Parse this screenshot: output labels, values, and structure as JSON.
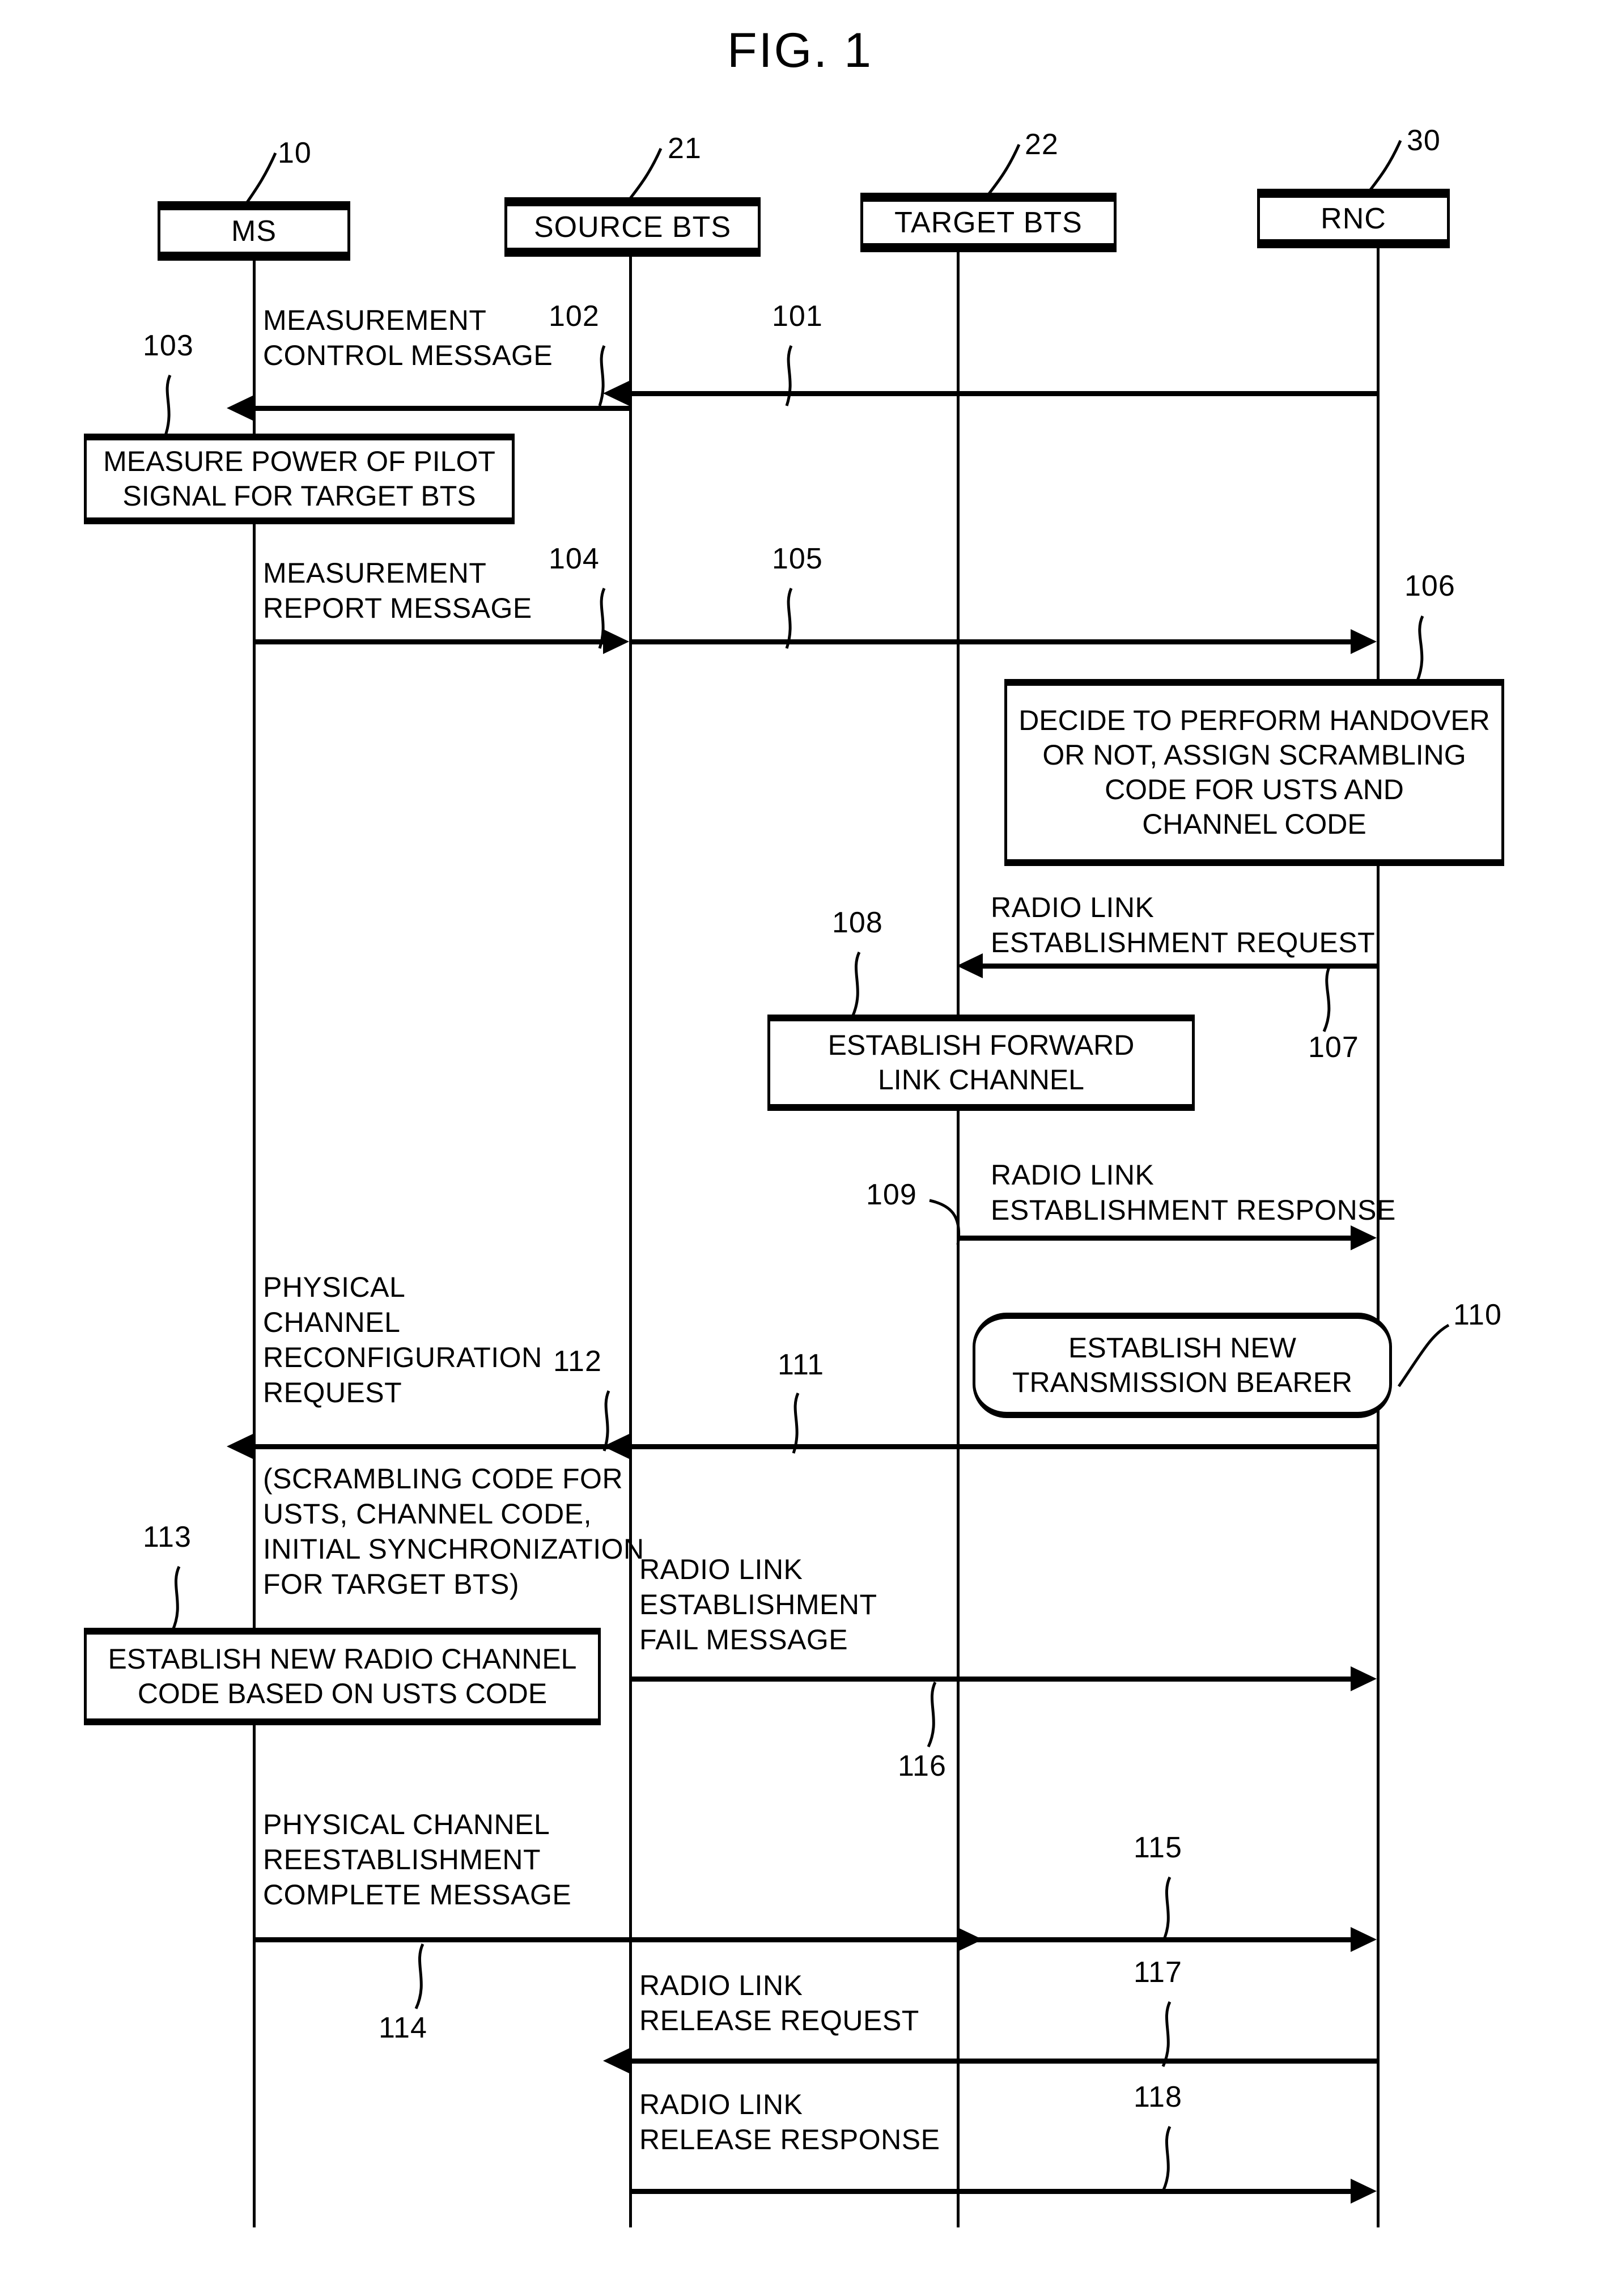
{
  "figure": {
    "title": "FIG. 1",
    "type": "patent-sequence-diagram"
  },
  "actors": [
    {
      "label": "MS",
      "ref": "10"
    },
    {
      "label": "SOURCE BTS",
      "ref": "21"
    },
    {
      "label": "TARGET BTS",
      "ref": "22"
    },
    {
      "label": "RNC",
      "ref": "30"
    }
  ],
  "messages": [
    {
      "ref": "101",
      "from": "RNC",
      "to": "SOURCE BTS",
      "label_line1": "",
      "label_line2": ""
    },
    {
      "ref": "102",
      "from": "SOURCE BTS",
      "to": "MS",
      "label_line1": "MEASUREMENT",
      "label_line2": "CONTROL MESSAGE"
    },
    {
      "ref": "104",
      "from": "MS",
      "to": "SOURCE BTS",
      "label_line1": "MEASUREMENT",
      "label_line2": "REPORT MESSAGE"
    },
    {
      "ref": "105",
      "from": "SOURCE BTS",
      "to": "RNC",
      "label_line1": "",
      "label_line2": ""
    },
    {
      "ref": "107",
      "from": "RNC",
      "to": "TARGET BTS",
      "label_line1": "RADIO LINK",
      "label_line2": "ESTABLISHMENT REQUEST"
    },
    {
      "ref": "109",
      "from": "TARGET BTS",
      "to": "RNC",
      "label_line1": "RADIO LINK",
      "label_line2": "ESTABLISHMENT RESPONSE"
    },
    {
      "ref": "111",
      "from": "RNC",
      "to": "SOURCE BTS",
      "label_line1": "",
      "label_line2": ""
    },
    {
      "ref": "112",
      "from": "SOURCE BTS",
      "to": "MS",
      "label_line1": "PHYSICAL CHANNEL RECONFIGURATION REQUEST",
      "label_line2": "(SCRAMBLING CODE FOR USTS, CHANNEL CODE, INITIAL SYNCHRONIZATION FOR TARGET BTS)"
    },
    {
      "ref": "116",
      "from": "SOURCE BTS",
      "to": "RNC",
      "label_line1": "RADIO LINK",
      "label_line2": "ESTABLISHMENT FAIL MESSAGE"
    },
    {
      "ref": "114",
      "from": "MS",
      "to": "SOURCE BTS",
      "label_line1": "PHYSICAL CHANNEL REESTABLISHMENT",
      "label_line2": "COMPLETE MESSAGE"
    },
    {
      "ref": "115",
      "from": "SOURCE BTS",
      "to": "RNC",
      "label_line1": "",
      "label_line2": ""
    },
    {
      "ref": "117",
      "from": "RNC",
      "to": "SOURCE BTS",
      "label_line1": "RADIO LINK",
      "label_line2": "RELEASE REQUEST"
    },
    {
      "ref": "118",
      "from": "SOURCE BTS",
      "to": "RNC",
      "label_line1": "RADIO LINK",
      "label_line2": "RELEASE RESPONSE"
    }
  ],
  "labels": {
    "m102_l1": "MEASUREMENT",
    "m102_l2": "CONTROL MESSAGE",
    "m104_l1": "MEASUREMENT",
    "m104_l2": "REPORT MESSAGE",
    "m107_l1": "RADIO LINK",
    "m107_l2": "ESTABLISHMENT REQUEST",
    "m109_l1": "RADIO LINK",
    "m109_l2": "ESTABLISHMENT RESPONSE",
    "m112_l1": "PHYSICAL",
    "m112_l2": "CHANNEL",
    "m112_l3": "RECONFIGURATION",
    "m112_l4": "REQUEST",
    "m112_p1": "(SCRAMBLING CODE FOR",
    "m112_p2": "USTS, CHANNEL CODE,",
    "m112_p3": "INITIAL SYNCHRONIZATION",
    "m112_p4": "FOR TARGET BTS)",
    "m116_l1": "RADIO LINK",
    "m116_l2": "ESTABLISHMENT",
    "m116_l3": "FAIL MESSAGE",
    "m114_l1": "PHYSICAL CHANNEL",
    "m114_l2": "REESTABLISHMENT",
    "m114_l3": "COMPLETE MESSAGE",
    "m117_l1": "RADIO LINK",
    "m117_l2": "RELEASE REQUEST",
    "m118_l1": "RADIO LINK",
    "m118_l2": "RELEASE RESPONSE"
  },
  "process_boxes": [
    {
      "ref": "103",
      "actor": "MS",
      "lines": [
        "MEASURE POWER OF PILOT",
        "SIGNAL FOR TARGET BTS"
      ],
      "shape": "rect"
    },
    {
      "ref": "106",
      "actor": "RNC",
      "lines": [
        "DECIDE TO PERFORM HANDOVER",
        "OR NOT, ASSIGN SCRAMBLING",
        "CODE FOR USTS AND",
        "CHANNEL CODE"
      ],
      "shape": "rect"
    },
    {
      "ref": "108",
      "actor": "TARGET BTS",
      "lines": [
        "ESTABLISH FORWARD",
        "LINK CHANNEL"
      ],
      "shape": "rect"
    },
    {
      "ref": "110",
      "actor": "RNC",
      "lines": [
        "ESTABLISH NEW",
        "TRANSMISSION BEARER"
      ],
      "shape": "rounded"
    },
    {
      "ref": "113",
      "actor": "MS",
      "lines": [
        "ESTABLISH NEW RADIO CHANNEL",
        "CODE BASED ON USTS CODE"
      ],
      "shape": "rect"
    }
  ],
  "process_text": {
    "p103_l1": "MEASURE POWER OF PILOT",
    "p103_l2": "SIGNAL FOR TARGET BTS",
    "p106_l1": "DECIDE TO PERFORM HANDOVER",
    "p106_l2": "OR NOT, ASSIGN SCRAMBLING",
    "p106_l3": "CODE FOR USTS AND",
    "p106_l4": "CHANNEL CODE",
    "p108_l1": "ESTABLISH FORWARD",
    "p108_l2": "LINK CHANNEL",
    "p110_l1": "ESTABLISH NEW",
    "p110_l2": "TRANSMISSION BEARER",
    "p113_l1": "ESTABLISH NEW RADIO CHANNEL",
    "p113_l2": "CODE BASED ON USTS CODE"
  },
  "refnums": {
    "n10": "10",
    "n21": "21",
    "n22": "22",
    "n30": "30",
    "n101": "101",
    "n102": "102",
    "n103": "103",
    "n104": "104",
    "n105": "105",
    "n106": "106",
    "n107": "107",
    "n108": "108",
    "n109": "109",
    "n110": "110",
    "n111": "111",
    "n112": "112",
    "n113": "113",
    "n114": "114",
    "n115": "115",
    "n116": "116",
    "n117": "117",
    "n118": "118"
  },
  "actor_labels": {
    "ms": "MS",
    "source_bts": "SOURCE BTS",
    "target_bts": "TARGET BTS",
    "rnc": "RNC"
  },
  "colors": {
    "ink": "#000000",
    "paper": "#ffffff"
  }
}
